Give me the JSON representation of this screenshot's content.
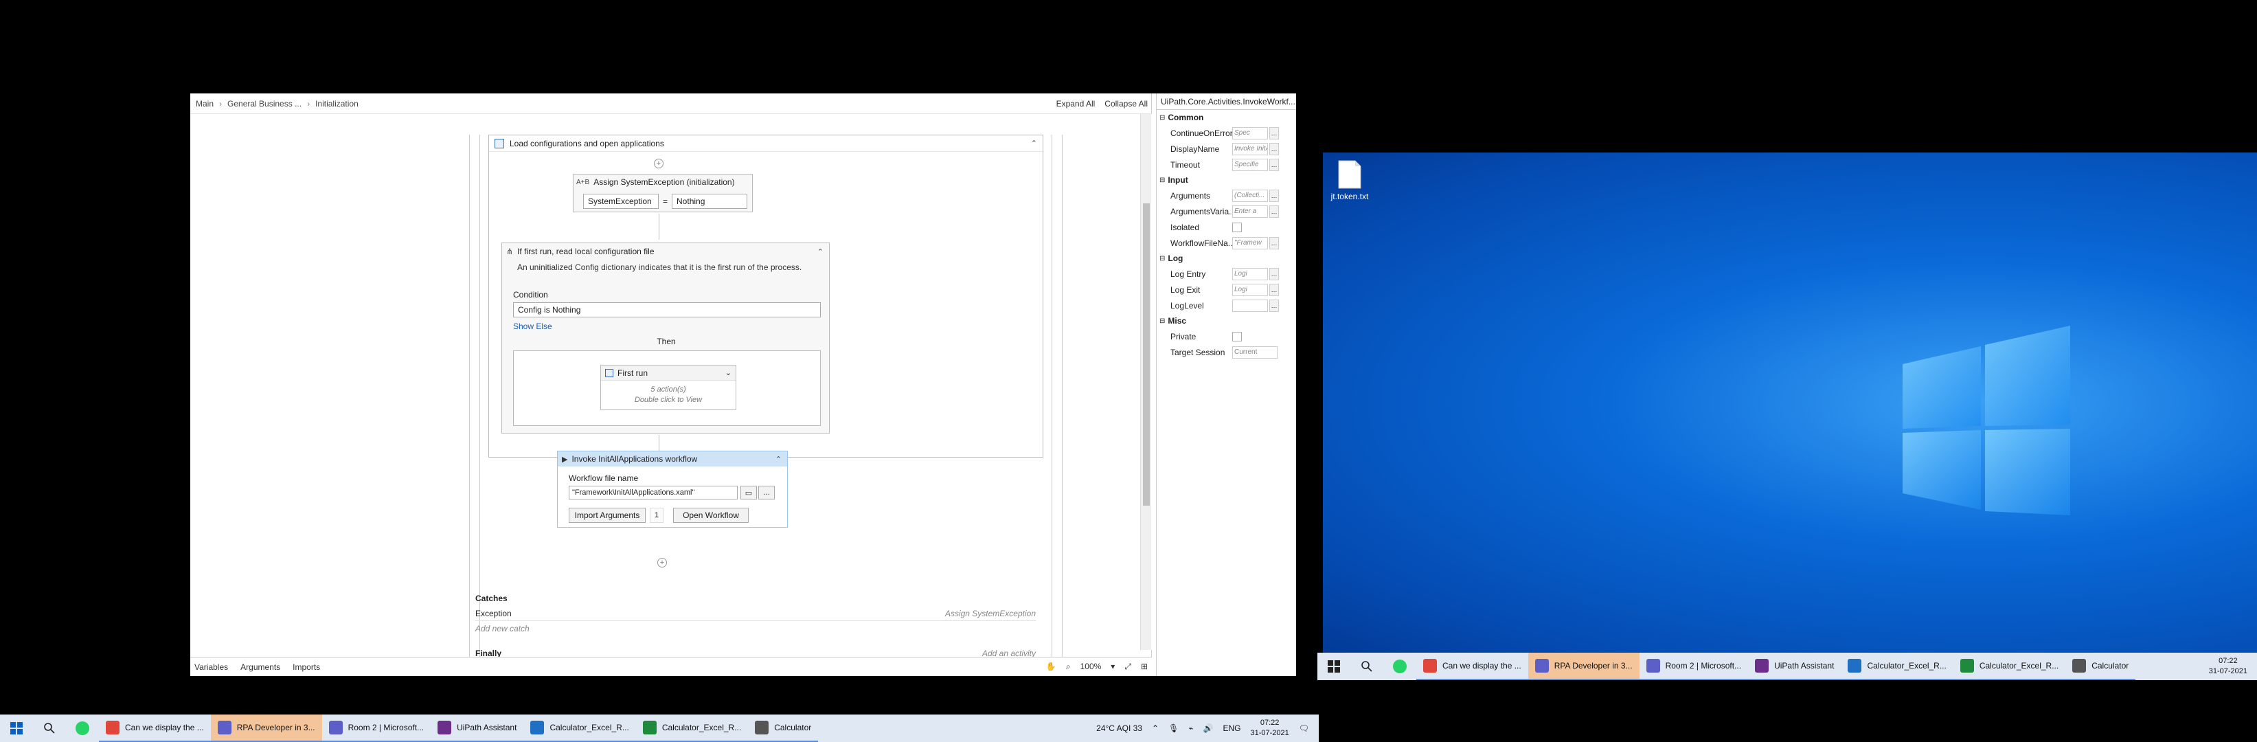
{
  "studio": {
    "breadcrumb": [
      "Main",
      "General Business ...",
      "Initialization"
    ],
    "expand_all": "Expand All",
    "collapse_all": "Collapse All",
    "bottom_tabs": [
      "Variables",
      "Arguments",
      "Imports"
    ],
    "zoom": "100%",
    "sequence_title": "Load configurations and open applications",
    "assign": {
      "title": "Assign SystemException (initialization)",
      "left": "SystemException",
      "op": "=",
      "right": "Nothing"
    },
    "if_block": {
      "title": "If first run, read local configuration file",
      "description": "An uninitialized Config dictionary indicates that it is the first run of the process.",
      "condition_label": "Condition",
      "condition_value": "Config is Nothing",
      "show_else": "Show Else",
      "then_label": "Then",
      "first_run_title": "First run",
      "first_run_actions": "5 action(s)",
      "first_run_hint": "Double click to View"
    },
    "invoke": {
      "title": "Invoke InitAllApplications workflow",
      "file_label": "Workflow file name",
      "file_value": "\"Framework\\InitAllApplications.xaml\"",
      "import_button": "Import Arguments",
      "arg_count": "1",
      "open_button": "Open Workflow"
    },
    "catches": {
      "title": "Catches",
      "exception": "Exception",
      "exception_action": "Assign SystemException",
      "add_catch": "Add new catch",
      "finally": "Finally",
      "add_activity": "Add an activity"
    }
  },
  "properties": {
    "title": "UiPath.Core.Activities.InvokeWorkf...",
    "categories": [
      {
        "name": "Common",
        "rows": [
          {
            "name": "ContinueOnError",
            "value": "Spec"
          },
          {
            "name": "DisplayName",
            "value": "Invoke InitA"
          },
          {
            "name": "Timeout",
            "value": "Specifie"
          }
        ]
      },
      {
        "name": "Input",
        "rows": [
          {
            "name": "Arguments",
            "value": "(Collecti..."
          },
          {
            "name": "ArgumentsVaria...",
            "value": "Enter a"
          },
          {
            "name": "Isolated",
            "value": ""
          },
          {
            "name": "WorkflowFileNa...",
            "value": "\"Framew"
          }
        ]
      },
      {
        "name": "Log",
        "rows": [
          {
            "name": "Log Entry",
            "value": "Logi"
          },
          {
            "name": "Log Exit",
            "value": "Logi"
          },
          {
            "name": "LogLevel",
            "value": ""
          }
        ]
      },
      {
        "name": "Misc",
        "rows": [
          {
            "name": "Private",
            "value": ""
          },
          {
            "name": "Target Session",
            "value": "Current"
          }
        ]
      }
    ]
  },
  "taskbar_left": {
    "apps": [
      {
        "label": "Can we display the ...",
        "icon": "chrome-icon",
        "color": "#e0463a"
      },
      {
        "label": "RPA Developer in 3...",
        "icon": "teams-icon",
        "color": "#5b5fc7"
      },
      {
        "label": "Room 2 | Microsoft...",
        "icon": "teams-icon",
        "color": "#5b5fc7"
      },
      {
        "label": "UiPath Assistant",
        "icon": "uipath-assistant-icon",
        "color": "#6b2e8a"
      },
      {
        "label": "Calculator_Excel_R...",
        "icon": "uipath-studio-icon",
        "color": "#1f6fc4"
      },
      {
        "label": "Calculator_Excel_R...",
        "icon": "excel-icon",
        "color": "#1f8a3c"
      },
      {
        "label": "Calculator",
        "icon": "calculator-icon",
        "color": "#555555"
      }
    ],
    "weather": "24°C  AQI 33",
    "lang": "ENG",
    "time": "07:22",
    "date": "31-07-2021"
  },
  "desktop": {
    "file_label": "jt.token.txt"
  },
  "taskbar_right": {
    "apps": [
      {
        "label": "Can we display the ...",
        "icon": "chrome-icon",
        "color": "#e0463a"
      },
      {
        "label": "RPA Developer in 3...",
        "icon": "teams-icon",
        "color": "#5b5fc7"
      },
      {
        "label": "Room 2 | Microsoft...",
        "icon": "teams-icon",
        "color": "#5b5fc7"
      },
      {
        "label": "UiPath Assistant",
        "icon": "uipath-assistant-icon",
        "color": "#6b2e8a"
      },
      {
        "label": "Calculator_Excel_R...",
        "icon": "uipath-studio-icon",
        "color": "#1f6fc4"
      },
      {
        "label": "Calculator_Excel_R...",
        "icon": "excel-icon",
        "color": "#1f8a3c"
      },
      {
        "label": "Calculator",
        "icon": "calculator-icon",
        "color": "#555555"
      }
    ],
    "time": "07:22",
    "date": "31-07-2021"
  }
}
